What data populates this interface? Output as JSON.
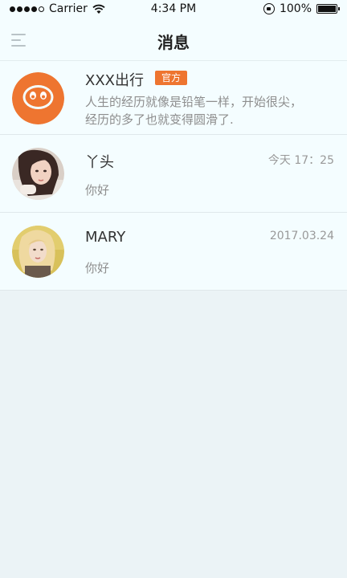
{
  "status_bar": {
    "carrier": "Carrier",
    "time": "4:34 PM",
    "battery": "100%"
  },
  "nav": {
    "title": "消息",
    "menu_icon": "menu-icon"
  },
  "messages": [
    {
      "sender": "XXX出行",
      "badge": "官方",
      "time": "",
      "preview_line1": "人生的经历就像是铅笔一样，开始很尖，",
      "preview_line2": "经历的多了也就变得圆滑了.",
      "avatar": "official-logo"
    },
    {
      "sender": "丫头",
      "time": "今天 17：25",
      "preview": "你好",
      "avatar": "user-photo"
    },
    {
      "sender": "MARY",
      "time": "2017.03.24",
      "preview": "你好",
      "avatar": "user-photo"
    }
  ],
  "colors": {
    "accent_orange": "#ee7530",
    "background": "#ebf3f6",
    "card": "#f4fdff"
  }
}
